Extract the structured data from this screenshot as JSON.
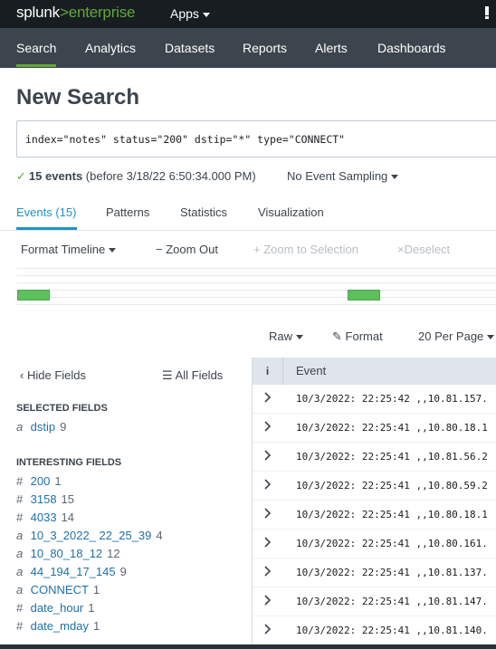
{
  "topbar": {
    "logo_brand": "splunk",
    "logo_sep": ">",
    "logo_product": "enterprise",
    "apps_label": "Apps"
  },
  "nav": {
    "items": [
      "Search",
      "Analytics",
      "Datasets",
      "Reports",
      "Alerts",
      "Dashboards"
    ],
    "active": "Search"
  },
  "page": {
    "title": "New Search"
  },
  "search": {
    "query": "index=\"notes\" status=\"200\" dstip=\"*\" type=\"CONNECT\""
  },
  "status": {
    "count_label": "15 events",
    "before_label": "(before 3/18/22 6:50:34.000 PM)",
    "sampling_label": "No Event Sampling"
  },
  "tabs": {
    "items": [
      "Events (15)",
      "Patterns",
      "Statistics",
      "Visualization"
    ],
    "active": "Events (15)"
  },
  "timeline_toolbar": {
    "format_timeline": "Format Timeline",
    "zoom_out": "Zoom Out",
    "zoom_to_selection": "Zoom to Selection",
    "deselect": "Deselect"
  },
  "results_toolbar": {
    "raw": "Raw",
    "format": "Format",
    "per_page": "20 Per Page"
  },
  "sidebar": {
    "hide_fields": "Hide Fields",
    "all_fields": "All Fields",
    "selected_heading": "SELECTED FIELDS",
    "selected_fields": [
      {
        "type": "a",
        "name": "dstip",
        "count": "9"
      }
    ],
    "interesting_heading": "INTERESTING FIELDS",
    "interesting_fields": [
      {
        "type": "#",
        "name": "200",
        "count": "1"
      },
      {
        "type": "#",
        "name": "3158",
        "count": "15"
      },
      {
        "type": "#",
        "name": "4033",
        "count": "14"
      },
      {
        "type": "a",
        "name": "10_3_2022_ 22_25_39",
        "count": "4"
      },
      {
        "type": "a",
        "name": "10_80_18_12",
        "count": "12"
      },
      {
        "type": "a",
        "name": "44_194_17_145",
        "count": "9"
      },
      {
        "type": "a",
        "name": "CONNECT",
        "count": "1"
      },
      {
        "type": "#",
        "name": "date_hour",
        "count": "1"
      },
      {
        "type": "#",
        "name": "date_mday",
        "count": "1"
      }
    ]
  },
  "events_table": {
    "info_header": "i",
    "event_header": "Event",
    "rows": [
      "10/3/2022: 22:25:42 ,,10.81.157.",
      "10/3/2022: 22:25:41 ,,10.80.18.1",
      "10/3/2022: 22:25:41 ,,10.81.56.2",
      "10/3/2022: 22:25:41 ,,10.80.59.2",
      "10/3/2022: 22:25:41 ,,10.80.18.1",
      "10/3/2022: 22:25:41 ,,10.80.161.",
      "10/3/2022: 22:25:41 ,,10.81.137.",
      "10/3/2022: 22:25:41 ,,10.81.147.",
      "10/3/2022: 22:25:41 ,,10.81.140."
    ]
  },
  "colors": {
    "topbar_bg": "#171d21",
    "nav_bg": "#3c444d",
    "accent_green": "#65a637",
    "accent_blue": "#1e93c6",
    "timeline_bar": "#5cc05c",
    "field_link": "#1e71a8"
  }
}
